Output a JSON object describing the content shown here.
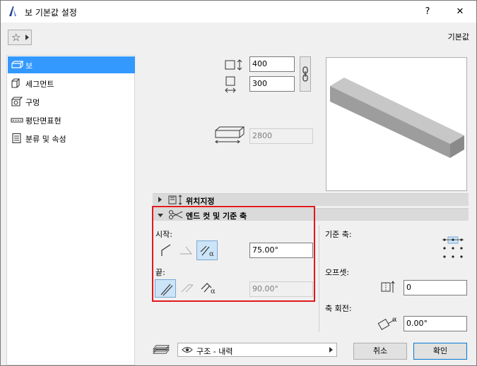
{
  "window": {
    "title": "보 기본값 설정",
    "help_label": "?",
    "close_label": "✕"
  },
  "header": {
    "defaults_label": "기본값"
  },
  "sidebar": {
    "items": [
      {
        "label": "보",
        "icon": "beam-icon",
        "selected": true
      },
      {
        "label": "세그먼트",
        "icon": "segment-icon",
        "selected": false
      },
      {
        "label": "구멍",
        "icon": "hole-icon",
        "selected": false
      },
      {
        "label": "평단면표현",
        "icon": "floor-plan-icon",
        "selected": false
      },
      {
        "label": "분류 및 속성",
        "icon": "classification-icon",
        "selected": false
      }
    ]
  },
  "geometry": {
    "width_value": "400",
    "height_value": "300",
    "length_value": "2800"
  },
  "sections": {
    "positioning_label": "위치지정",
    "end_cut_label": "엔드 컷 및 기준 축"
  },
  "end_cut": {
    "start_label": "시작:",
    "start_angle": "75.00°",
    "end_label": "끝:",
    "end_angle": "90.00°"
  },
  "reference_axis": {
    "label": "기준 축:",
    "offset_label": "오프셋:",
    "offset_value": "0",
    "rotation_label": "축 회전:",
    "rotation_value": "0.00°"
  },
  "footer": {
    "layer_value": "구조 - 내력",
    "cancel_label": "취소",
    "ok_label": "확인"
  },
  "colors": {
    "selection": "#3399ff",
    "highlight_box": "#e0181b",
    "toggle_on": "#cce4f7"
  }
}
